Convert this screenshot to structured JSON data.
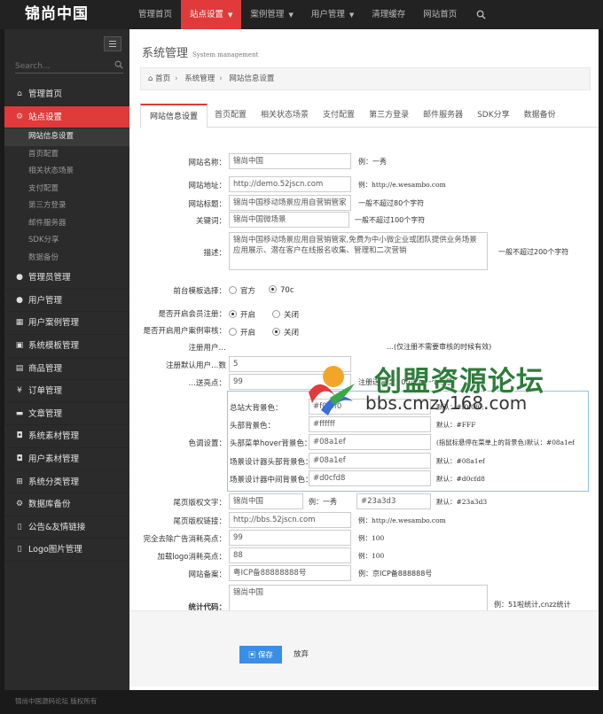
{
  "brand": {
    "logo": "锦尚中国"
  },
  "topnav": {
    "items": [
      "管理首页",
      "站点设置",
      "案例管理",
      "用户管理",
      "清理缓存",
      "网站首页"
    ],
    "active_index": 1
  },
  "sidebar": {
    "search_placeholder": "Search...",
    "menu": [
      {
        "label": "管理首页",
        "icon": "home-icon"
      },
      {
        "label": "站点设置",
        "icon": "gears-icon"
      },
      {
        "label": "管理员管理",
        "icon": "user-icon"
      },
      {
        "label": "用户管理",
        "icon": "user-icon"
      },
      {
        "label": "用户案例管理",
        "icon": "table-icon"
      },
      {
        "label": "系统模板管理",
        "icon": "briefcase-icon"
      },
      {
        "label": "商品管理",
        "icon": "box-icon"
      },
      {
        "label": "订单管理",
        "icon": "yen-icon"
      },
      {
        "label": "文章管理",
        "icon": "truck-icon"
      },
      {
        "label": "系统素材管理",
        "icon": "gift-icon"
      },
      {
        "label": "用户素材管理",
        "icon": "gift-icon"
      },
      {
        "label": "系统分类管理",
        "icon": "sitemap-icon"
      },
      {
        "label": "数据库备份",
        "icon": "gears-icon"
      },
      {
        "label": "公告&友情链接",
        "icon": "bookmark-icon"
      },
      {
        "label": "Logo图片管理",
        "icon": "bookmark-icon"
      }
    ],
    "submenu": [
      "网站信息设置",
      "首页配置",
      "相关状态场景",
      "支付配置",
      "第三方登录",
      "邮件服务器",
      "SDK分享",
      "数据备份"
    ],
    "footer": "锦尚中国源码论坛 版权所有"
  },
  "page": {
    "title": "系统管理",
    "subtitle": "System management",
    "breadcrumb": [
      "首页",
      "系统管理",
      "网站信息设置"
    ]
  },
  "tabs": [
    "网站信息设置",
    "首页配置",
    "相关状态场景",
    "支付配置",
    "第三方登录",
    "邮件服务器",
    "SDK分享",
    "数据备份"
  ],
  "form": {
    "site_name": {
      "label": "网站名称：",
      "value": "锦尚中国",
      "hint": "例：一秀"
    },
    "site_url": {
      "label": "网站地址：",
      "value": "http://demo.52jscn.com",
      "hint": "例：http://e.wesambo.com"
    },
    "site_title": {
      "label": "网站标题：",
      "value": "锦尚中国移动场景应用自营销管家",
      "hint": "一般不超过80个字符"
    },
    "keywords": {
      "label": "关键词：",
      "value": "锦尚中国微场景",
      "hint": "一般不超过100个字符"
    },
    "description": {
      "label": "描述：",
      "value": "锦尚中国移动场景应用自营销管家,免费为中小微企业或团队提供业务场景应用展示、潜在客户在线报名收集、管理和二次营销",
      "hint": "一般不超过200个字符"
    },
    "front_template": {
      "label": "前台模板选择：",
      "options": [
        "官方",
        "70c"
      ],
      "selected": 1
    },
    "member_register": {
      "label": "是否开启会员注册：",
      "options": [
        "开启",
        "关闭"
      ],
      "selected": 0
    },
    "user_case_audit": {
      "label": "是否开启用户案例审核：",
      "options": [
        "开启",
        "关闭"
      ],
      "selected": 1
    },
    "audit_note": {
      "label": "注册用户…",
      "hint": "…(仅注册不需要审核的时候有效)"
    },
    "default_points": {
      "label": "注册默认用户…数",
      "value": "5"
    },
    "scene_points": {
      "label": "…送亮点：",
      "value": "99",
      "hint": "注册送亮点(200点为一个场景)"
    },
    "colors": {
      "label": "色调设置：",
      "rows": [
        {
          "label": "总站大背景色：",
          "value": "#f0f0f0",
          "hint": "默认：#f0f0f0;"
        },
        {
          "label": "头部背景色：",
          "value": "#ffffff",
          "hint": "默认：#FFF"
        },
        {
          "label": "头部菜单hover背景色：",
          "value": "#08a1ef",
          "hint": "(指鼠标悬停在菜单上的背景色)默认：#08a1ef"
        },
        {
          "label": "场景设计器头部背景色：",
          "value": "#08a1ef",
          "hint": "默认：#08a1ef"
        },
        {
          "label": "场景设计器中间背景色：",
          "value": "#d0cfd8",
          "hint": "默认：#d0cfd8"
        }
      ]
    },
    "tail_text": {
      "label": "尾页版权文字：",
      "value": "锦尚中国",
      "hint": "例：一秀",
      "color_value": "#23a3d3",
      "color_hint": "默认：#23a3d3"
    },
    "tail_link": {
      "label": "尾页版权链接：",
      "value": "http://bbs.52jscn.com",
      "hint": "例：http://e.wesambo.com"
    },
    "remove_ad": {
      "label": "完全去除广告消耗亮点：",
      "value": "99",
      "hint": "例：100"
    },
    "add_logo": {
      "label": "加载logo消耗亮点：",
      "value": "88",
      "hint": "例：100"
    },
    "icp": {
      "label": "网站备案：",
      "value": "粤ICP备88888888号",
      "hint": "例：京ICP备888888号"
    },
    "stats_code": {
      "label": "统计代码：",
      "value": "锦尚中国",
      "hint": "例：51啦统计,cnzz统计"
    }
  },
  "actions": {
    "save": "保存",
    "cancel": "放弃"
  },
  "watermark": {
    "title": "创盟资源论坛",
    "url": "bbs.cmzy168.com"
  },
  "colors": {
    "accent": "#e03a3a",
    "primary_button": "#3a8ee6",
    "topbar": "#222222",
    "sidebar": "#2b2b2b"
  }
}
